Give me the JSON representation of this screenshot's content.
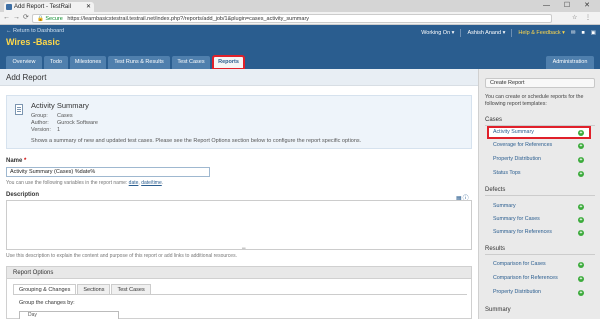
{
  "browser": {
    "tab_title": "Add Report - TestRail",
    "secure_label": "Secure",
    "url": "https://learnbasicstestrail.testrail.net/index.php?/reports/add_job/1&plugin=cases_activity_summary"
  },
  "header": {
    "return_link": "← Return to Dashboard",
    "project_name": "Wires -Basic",
    "working_on": "Working On ▾",
    "user": "Ashish Anand ▾",
    "help": "Help & Feedback ▾"
  },
  "nav": {
    "tabs": [
      {
        "label": "Overview"
      },
      {
        "label": "Todo"
      },
      {
        "label": "Milestones"
      },
      {
        "label": "Test Runs & Results"
      },
      {
        "label": "Test Cases"
      },
      {
        "label": "Reports"
      }
    ],
    "admin": "Administration"
  },
  "main": {
    "page_title": "Add Report",
    "summary": {
      "title": "Activity Summary",
      "group_key": "Group:",
      "group_val": "Cases",
      "author_key": "Author:",
      "author_val": "Gurock Software",
      "version_key": "Version:",
      "version_val": "1",
      "description": "Shows a summary of new and updated test cases. Please see the Report Options section below to configure the report specific options."
    },
    "name_label": "Name",
    "name_required": "*",
    "name_value": "Activity Summary (Cases) %date%",
    "name_hint": "You can use the following variables in the report name:",
    "var_date": "date",
    "var_datetime": "date/time",
    "desc_label": "Description",
    "desc_hint": "Use this description to explain the content and purpose of this report or add links to additional resources.",
    "report_options": {
      "title": "Report Options",
      "tabs": [
        {
          "label": "Grouping & Changes"
        },
        {
          "label": "Sections"
        },
        {
          "label": "Test Cases"
        }
      ],
      "group_label": "Group the changes by:",
      "dropdown_fragment": "Day"
    }
  },
  "sidebar": {
    "create_button": "Create Report",
    "intro": "You can create or schedule reports for the following report templates:",
    "sections": [
      {
        "title": "Cases",
        "items": [
          "Activity Summary",
          "Coverage for References",
          "Property Distribution",
          "Status Tops"
        ]
      },
      {
        "title": "Defects",
        "items": [
          "Summary",
          "Summary for Cases",
          "Summary for References"
        ]
      },
      {
        "title": "Results",
        "items": [
          "Comparison for Cases",
          "Comparison for References",
          "Property Distribution"
        ]
      },
      {
        "title": "Summary",
        "items": []
      }
    ]
  },
  "colors": {
    "header_blue": "#2a5d8f",
    "project_yellow": "#ffd84a",
    "highlight_red": "#e0202a",
    "add_green": "#3cab3c"
  }
}
